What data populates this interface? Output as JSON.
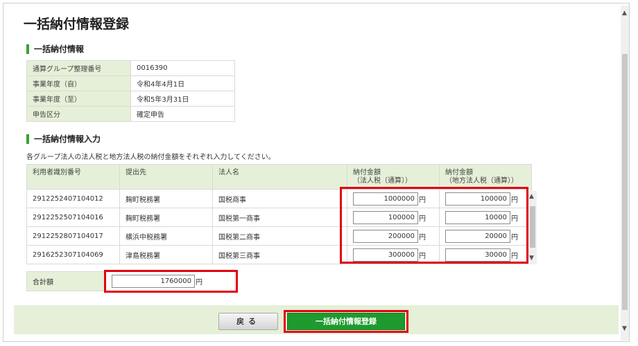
{
  "page_title": "一括納付情報登録",
  "info_section": {
    "heading": "一括納付情報",
    "rows": [
      {
        "label": "通算グループ整理番号",
        "value": "0016390"
      },
      {
        "label": "事業年度（自）",
        "value": "令和4年4月1日"
      },
      {
        "label": "事業年度（至）",
        "value": "令和5年3月31日"
      },
      {
        "label": "申告区分",
        "value": "確定申告"
      }
    ]
  },
  "input_section": {
    "heading": "一括納付情報入力",
    "instruction": "各グループ法人の法人税と地方法人税の納付金額をそれぞれ入力してください。",
    "columns": {
      "user_id": "利用者識別番号",
      "office": "提出先",
      "corp_name": "法人名",
      "corp_tax_line1": "納付金額",
      "corp_tax_line2": "（法人税（通算））",
      "local_tax_line1": "納付金額",
      "local_tax_line2": "（地方法人税（通算））"
    },
    "currency": "円",
    "rows": [
      {
        "user_id": "2912252407104012",
        "office": "麹町税務署",
        "corp_name": "国税商事",
        "corp_tax": "1000000",
        "local_tax": "100000"
      },
      {
        "user_id": "2912252507104016",
        "office": "麹町税務署",
        "corp_name": "国税第一商事",
        "corp_tax": "100000",
        "local_tax": "10000"
      },
      {
        "user_id": "2912252807104017",
        "office": "横浜中税務署",
        "corp_name": "国税第二商事",
        "corp_tax": "200000",
        "local_tax": "20000"
      },
      {
        "user_id": "2916252307104069",
        "office": "津島税務署",
        "corp_name": "国税第三商事",
        "corp_tax": "300000",
        "local_tax": "30000"
      }
    ]
  },
  "total": {
    "label": "合計額",
    "value": "1760000",
    "currency": "円"
  },
  "buttons": {
    "back": "戻る",
    "register": "一括納付情報登録"
  },
  "icons": {
    "scroll_up": "chevron-up-icon",
    "scroll_down": "chevron-down-icon"
  },
  "colors": {
    "accent_green": "#1e9a2e",
    "header_bg": "#e6f0d8",
    "highlight_red": "#e1000f"
  }
}
